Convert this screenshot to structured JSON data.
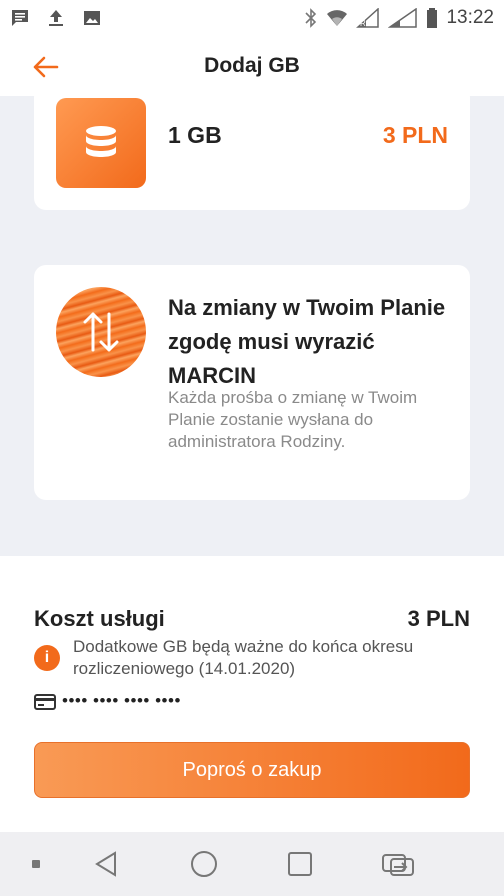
{
  "status_bar": {
    "time": "13:22",
    "icons": [
      "message-icon",
      "upload-icon",
      "image-icon",
      "bluetooth-icon",
      "wifi-icon",
      "signal-icon",
      "signal-icon",
      "battery-icon"
    ]
  },
  "header": {
    "title": "Dodaj GB",
    "back_icon": "arrow-left-icon"
  },
  "package": {
    "amount": "1 GB",
    "price": "3 PLN",
    "icon": "database-icon"
  },
  "info_card": {
    "title": "Na zmiany w Twoim Planie zgodę musi wyrazić MARCIN",
    "description": "Każda prośba o zmianę w Twoim Planie zostanie wysłana do administratora Rodziny.",
    "icon": "swap-vertical-icon"
  },
  "summary": {
    "cost_label": "Koszt usługi",
    "cost_value": "3 PLN",
    "note": "Dodatkowe GB będą ważne do końca okresu rozliczeniowego (14.01.2020)",
    "card_number": "•••• •••• •••• ••••"
  },
  "action": {
    "button_label": "Poproś o zakup"
  },
  "colors": {
    "accent": "#f26a1b",
    "background": "#eef0f5"
  }
}
